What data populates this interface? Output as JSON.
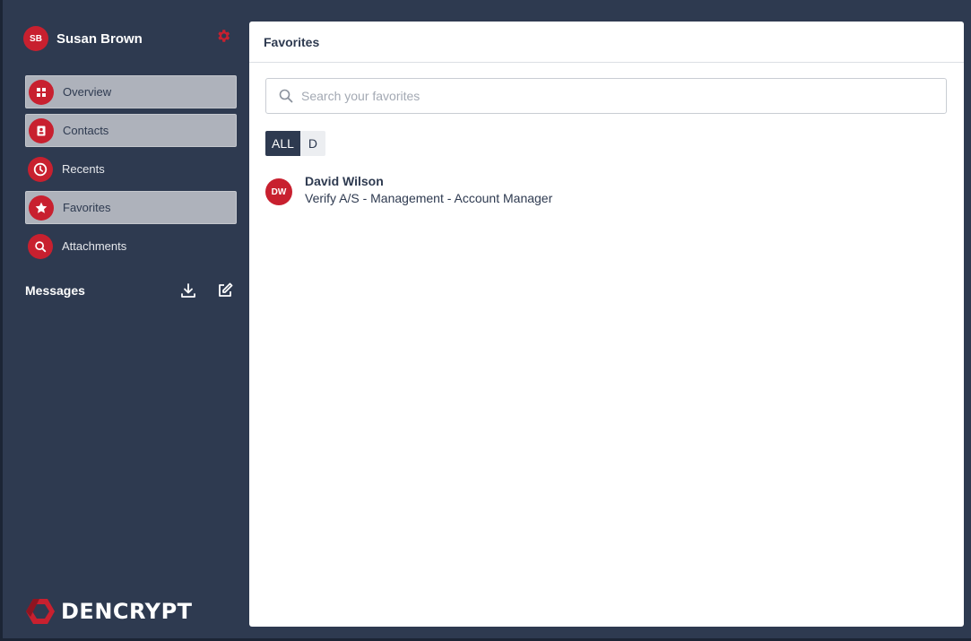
{
  "user": {
    "initials": "SB",
    "name": "Susan Brown"
  },
  "nav": [
    {
      "label": "Overview",
      "icon": "grid-icon"
    },
    {
      "label": "Contacts",
      "icon": "contact-card-icon"
    },
    {
      "label": "Recents",
      "icon": "clock-icon"
    },
    {
      "label": "Favorites",
      "icon": "star-icon"
    },
    {
      "label": "Attachments",
      "icon": "search-icon"
    }
  ],
  "messages": {
    "title": "Messages"
  },
  "brand": {
    "name": "DENCRYPT"
  },
  "panel": {
    "title": "Favorites",
    "search_placeholder": "Search your favorites",
    "filters": [
      "ALL",
      "D"
    ]
  },
  "contacts": [
    {
      "initials": "DW",
      "name": "David Wilson",
      "title": "Verify A/S - Management - Account Manager"
    }
  ],
  "colors": {
    "accent": "#c8202f",
    "sidebar": "#2e3a50",
    "nav_box": "#aeb2bb"
  }
}
